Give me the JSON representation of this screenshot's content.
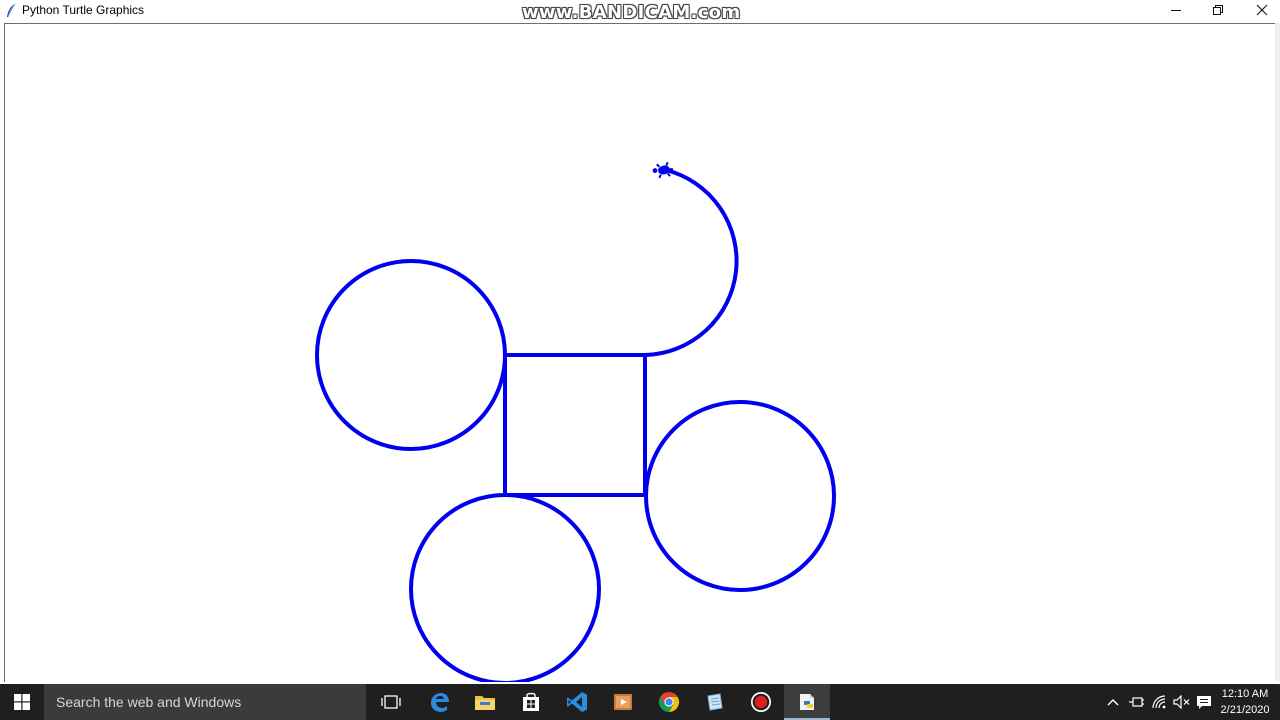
{
  "window": {
    "title": "Python Turtle Graphics",
    "watermark": "www.BANDICAM.com"
  },
  "canvas": {
    "pen_color": "#0000ee",
    "background": "#ffffff",
    "shapes": [
      {
        "kind": "circle",
        "name": "circle-left"
      },
      {
        "kind": "square",
        "name": "square-center"
      },
      {
        "kind": "circle",
        "name": "circle-right"
      },
      {
        "kind": "circle",
        "name": "circle-bottom"
      },
      {
        "kind": "arc",
        "name": "arc-top"
      }
    ],
    "turtle_icon": "turtle-cursor-icon"
  },
  "taskbar": {
    "search_placeholder": "Search the web and Windows",
    "apps": [
      "task-view-icon",
      "edge-icon",
      "file-explorer-icon",
      "store-icon",
      "vscode-icon",
      "media-player-icon",
      "chrome-icon",
      "notepad-icon",
      "bandicam-record-icon",
      "python-turtle-icon"
    ],
    "clock": {
      "time": "12:10 AM",
      "date": "2/21/2020"
    }
  }
}
